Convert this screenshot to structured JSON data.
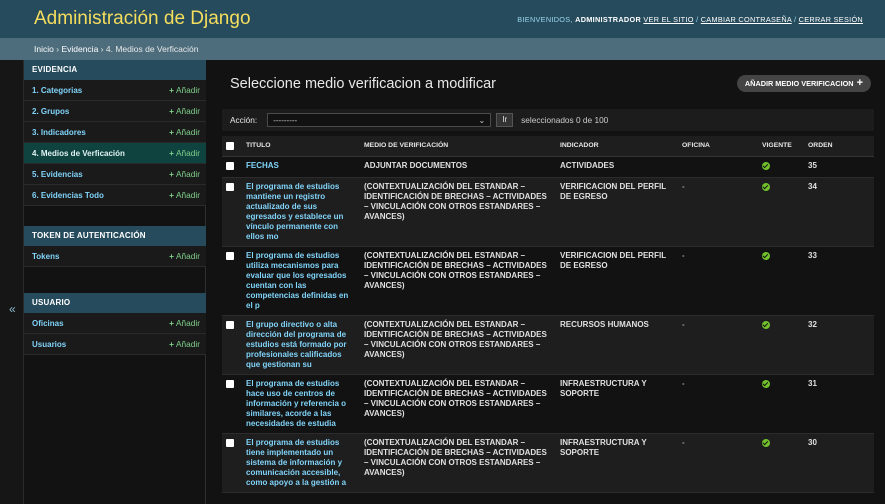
{
  "header": {
    "branding": "Administración de Django",
    "welcome": "BIENVENIDOS,",
    "username": "ADMINISTRADOR",
    "view_site": "VER EL SITIO",
    "change_password": "CAMBIAR CONTRASEÑA",
    "logout": "CERRAR SESIÓN",
    "separator": "/"
  },
  "breadcrumbs": {
    "home": "Inicio",
    "app": "Evidencia",
    "current": "4. Medios de Verficación",
    "separator": "›"
  },
  "sidebar": {
    "toggle_icon": "«",
    "modules": [
      {
        "caption": "EVIDENCIA",
        "rows": [
          {
            "label": "1. Categorias",
            "add": "Añadir",
            "current": false
          },
          {
            "label": "2. Grupos",
            "add": "Añadir",
            "current": false
          },
          {
            "label": "3. Indicadores",
            "add": "Añadir",
            "current": false
          },
          {
            "label": "4. Medios de Verficación",
            "add": "Añadir",
            "current": true
          },
          {
            "label": "5. Evidencias",
            "add": "Añadir",
            "current": false
          },
          {
            "label": "6. Evidencias Todo",
            "add": "Añadir",
            "current": false
          }
        ]
      },
      {
        "caption": "TOKEN DE AUTENTICACIÓN",
        "rows": [
          {
            "label": "Tokens",
            "add": "Añadir",
            "current": false
          }
        ]
      },
      {
        "caption": "USUARIO",
        "rows": [
          {
            "label": "Oficinas",
            "add": "Añadir",
            "current": false
          },
          {
            "label": "Usuarios",
            "add": "Añadir",
            "current": false
          }
        ]
      }
    ]
  },
  "content": {
    "title": "Seleccione medio verificacion a modificar",
    "add_button": "AÑADIR MEDIO VERIFICACION",
    "actions": {
      "label": "Acción:",
      "select_value": "---------",
      "go": "Ir",
      "selected": "seleccionados 0 de 100"
    },
    "columns": [
      "TITULO",
      "MEDIO DE VERIFICACIÓN",
      "INDICADOR",
      "OFICINA",
      "VIGENTE",
      "ORDEN"
    ],
    "rows": [
      {
        "titulo": "FECHAS",
        "medio": "ADJUNTAR DOCUMENTOS",
        "indicador": "ACTIVIDADES",
        "oficina": "",
        "vigente": true,
        "orden": "35"
      },
      {
        "titulo": "El programa de estudios mantiene un registro actualizado de sus egresados y establece un vínculo permanente con ellos mo",
        "medio": "(CONTEXTUALIZACIÓN DEL ESTANDAR – IDENTIFICACIÓN DE BRECHAS – ACTIVIDADES – VINCULACIÓN CON OTROS ESTANDARES – AVANCES)",
        "indicador": "VERIFICACION DEL PERFIL DE EGRESO",
        "oficina": "-",
        "vigente": true,
        "orden": "34"
      },
      {
        "titulo": "El programa de estudios utiliza mecanismos para evaluar que los egresados cuentan con las competencias definidas en el p",
        "medio": "(CONTEXTUALIZACIÓN DEL ESTANDAR – IDENTIFICACIÓN DE BRECHAS – ACTIVIDADES – VINCULACIÓN CON OTROS ESTANDARES – AVANCES)",
        "indicador": "VERIFICACION DEL PERFIL DE EGRESO",
        "oficina": "-",
        "vigente": true,
        "orden": "33"
      },
      {
        "titulo": "El grupo directivo o alta dirección del programa de estudios está formado por profesionales calificados que gestionan su",
        "medio": "(CONTEXTUALIZACIÓN DEL ESTANDAR – IDENTIFICACIÓN DE BRECHAS – ACTIVIDADES – VINCULACIÓN CON OTROS ESTANDARES – AVANCES)",
        "indicador": "RECURSOS HUMANOS",
        "oficina": "-",
        "vigente": true,
        "orden": "32"
      },
      {
        "titulo": "El programa de estudios hace uso de centros de información y referencia o similares, acorde a las necesidades de estudia",
        "medio": "(CONTEXTUALIZACIÓN DEL ESTANDAR – IDENTIFICACIÓN DE BRECHAS – ACTIVIDADES – VINCULACIÓN CON OTROS ESTANDARES – AVANCES)",
        "indicador": "INFRAESTRUCTURA Y SOPORTE",
        "oficina": "-",
        "vigente": true,
        "orden": "31"
      },
      {
        "titulo": "El programa de estudios tiene implementado un sistema de información y comunicación accesible, como apoyo a la gestión a",
        "medio": "(CONTEXTUALIZACIÓN DEL ESTANDAR – IDENTIFICACIÓN DE BRECHAS – ACTIVIDADES – VINCULACIÓN CON OTROS ESTANDARES – AVANCES)",
        "indicador": "INFRAESTRUCTURA Y SOPORTE",
        "oficina": "-",
        "vigente": true,
        "orden": "30"
      }
    ]
  },
  "colors": {
    "header_bg": "#264b5d",
    "branding": "#f5dd5d",
    "link": "#81d4fa",
    "add": "#7fd18a",
    "vigente_ok": "#70bf2b"
  }
}
